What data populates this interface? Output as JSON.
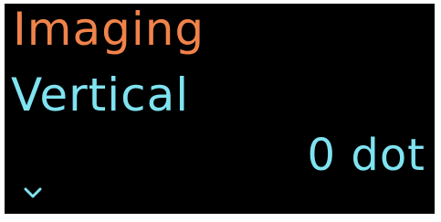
{
  "display": {
    "menu_title": "Imaging",
    "setting_name": "Vertical",
    "setting_value": "0 dot",
    "scroll_indicator_icon": "chevron-down-icon"
  },
  "colors": {
    "background": "#000000",
    "title": "#f0834a",
    "text": "#7fe3f0"
  }
}
